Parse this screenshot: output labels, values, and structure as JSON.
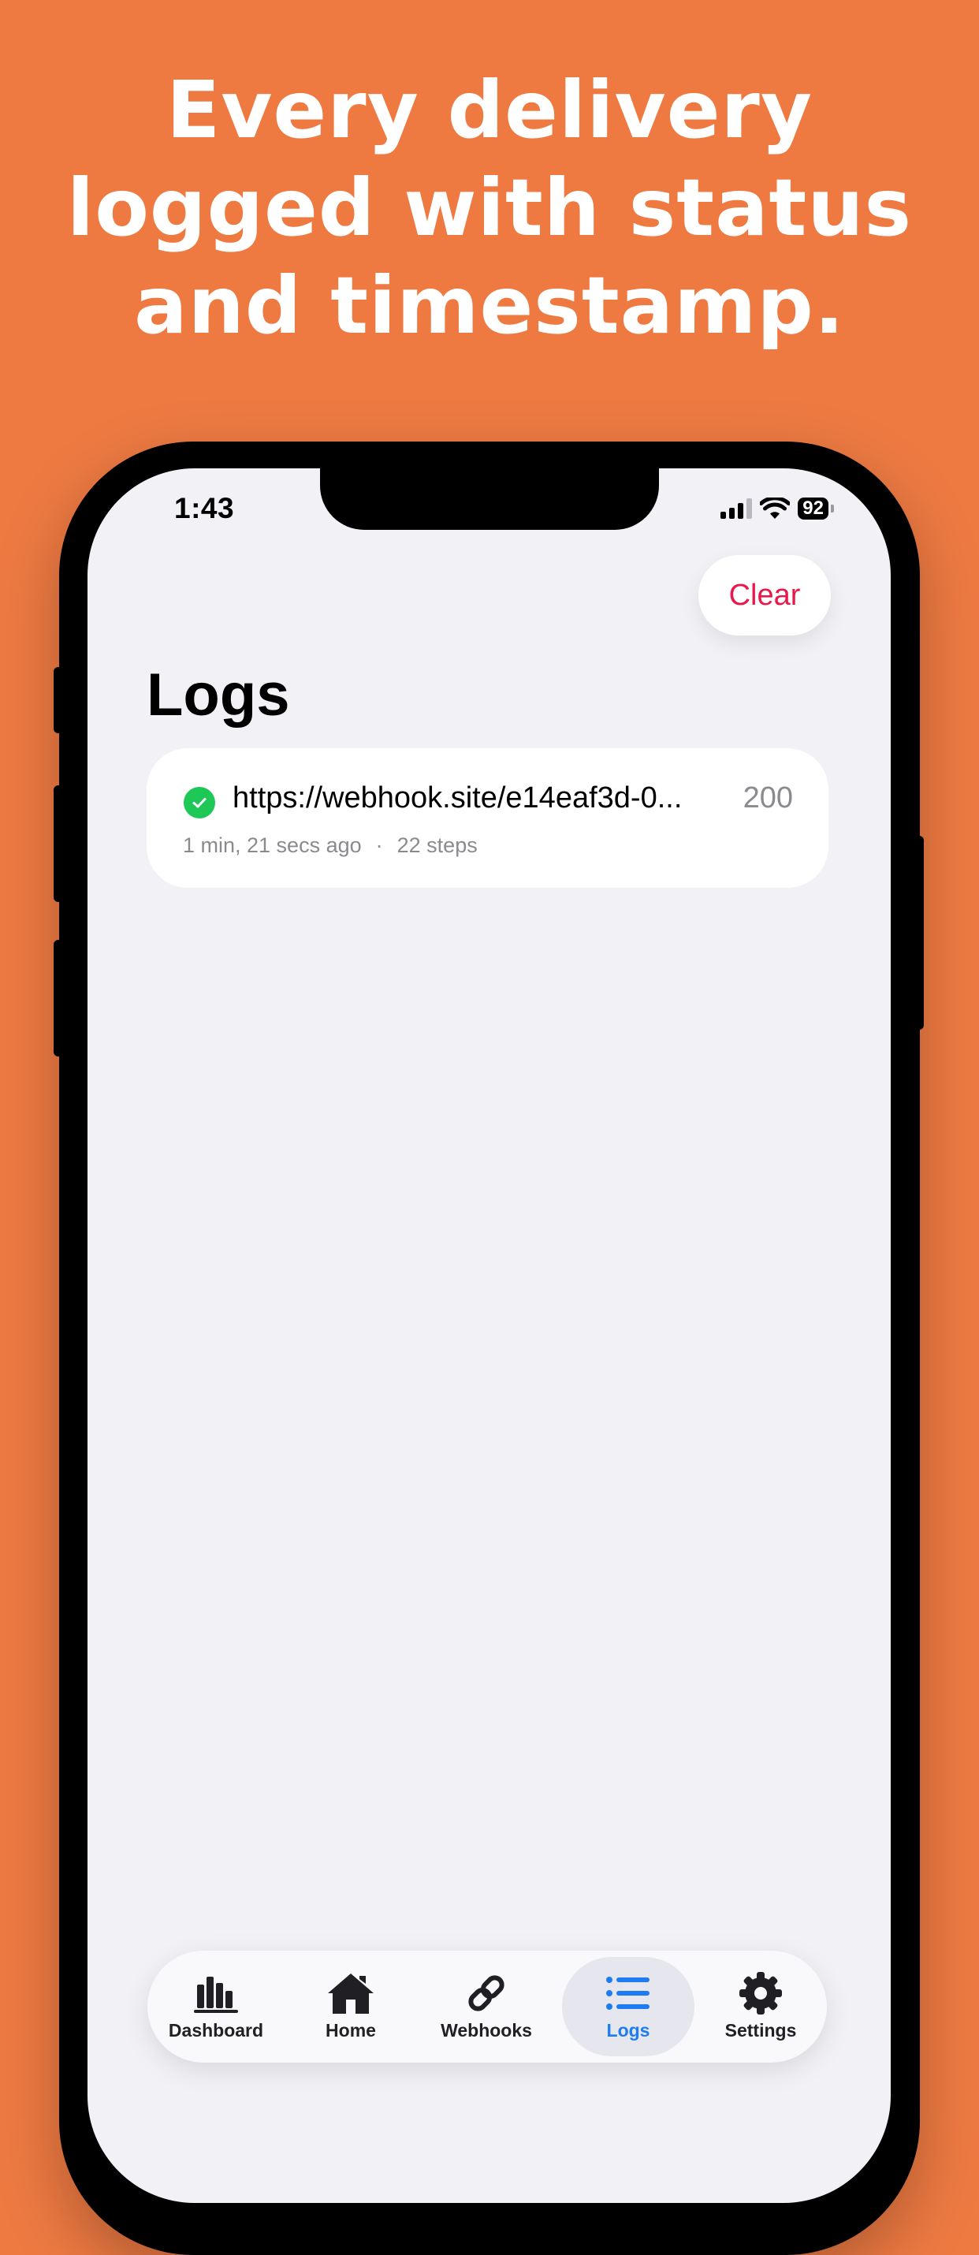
{
  "headline": {
    "line1": "Every delivery",
    "line2": "logged with status",
    "line3": "and timestamp."
  },
  "status_bar": {
    "time": "1:43",
    "battery": "92",
    "icons": [
      "cellular-signal-icon",
      "wifi-icon",
      "battery-icon"
    ]
  },
  "header": {
    "clear_label": "Clear",
    "title": "Logs"
  },
  "logs": [
    {
      "status_icon": "check-circle-icon",
      "url": "https://webhook.site/e14eaf3d-0...",
      "code": "200",
      "time_ago": "1 min, 21 secs ago",
      "separator": "·",
      "steps": "22 steps"
    }
  ],
  "tabs": [
    {
      "label": "Dashboard",
      "icon": "bar-chart-icon",
      "active": false
    },
    {
      "label": "Home",
      "icon": "house-icon",
      "active": false
    },
    {
      "label": "Webhooks",
      "icon": "link-icon",
      "active": false
    },
    {
      "label": "Logs",
      "icon": "list-icon",
      "active": true
    },
    {
      "label": "Settings",
      "icon": "gear-icon",
      "active": false
    }
  ],
  "colors": {
    "background": "#EE7A42",
    "screen": "#F1F1F6",
    "destructive": "#E8194A",
    "success": "#1DC857",
    "accent": "#1E7CF2",
    "secondary_text": "#8A8A8F"
  }
}
